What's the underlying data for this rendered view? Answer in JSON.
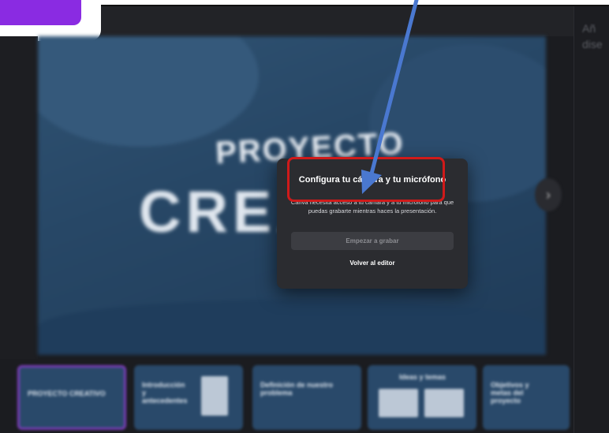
{
  "slide": {
    "heading_small": "PROYECTO",
    "heading_large": "CREA"
  },
  "right_panel": {
    "text": "Añ\ndise"
  },
  "dialog": {
    "title": "Configura tu cámara y tu micrófono",
    "body": "Canva necesita acceso a tu cámara y a tu micrófono para que puedas grabarte mientras haces la presentación.",
    "primary_button": "Empezar a grabar",
    "secondary_link": "Volver al editor"
  },
  "thumbnails": [
    {
      "label": "PROYECTO CREATIVO"
    },
    {
      "label": "Introducción y antecedentes"
    },
    {
      "label": "Definición de nuestro problema"
    },
    {
      "label": "Ideas y temas"
    },
    {
      "label": "Objetivos y metas del proyecto"
    }
  ],
  "icons": {
    "next": "chevron-right-icon",
    "annotation": "arrow-annotation-icon"
  },
  "colors": {
    "highlight": "#d01a1a",
    "arrow": "#4a78d0",
    "accent": "#8a2be2"
  }
}
